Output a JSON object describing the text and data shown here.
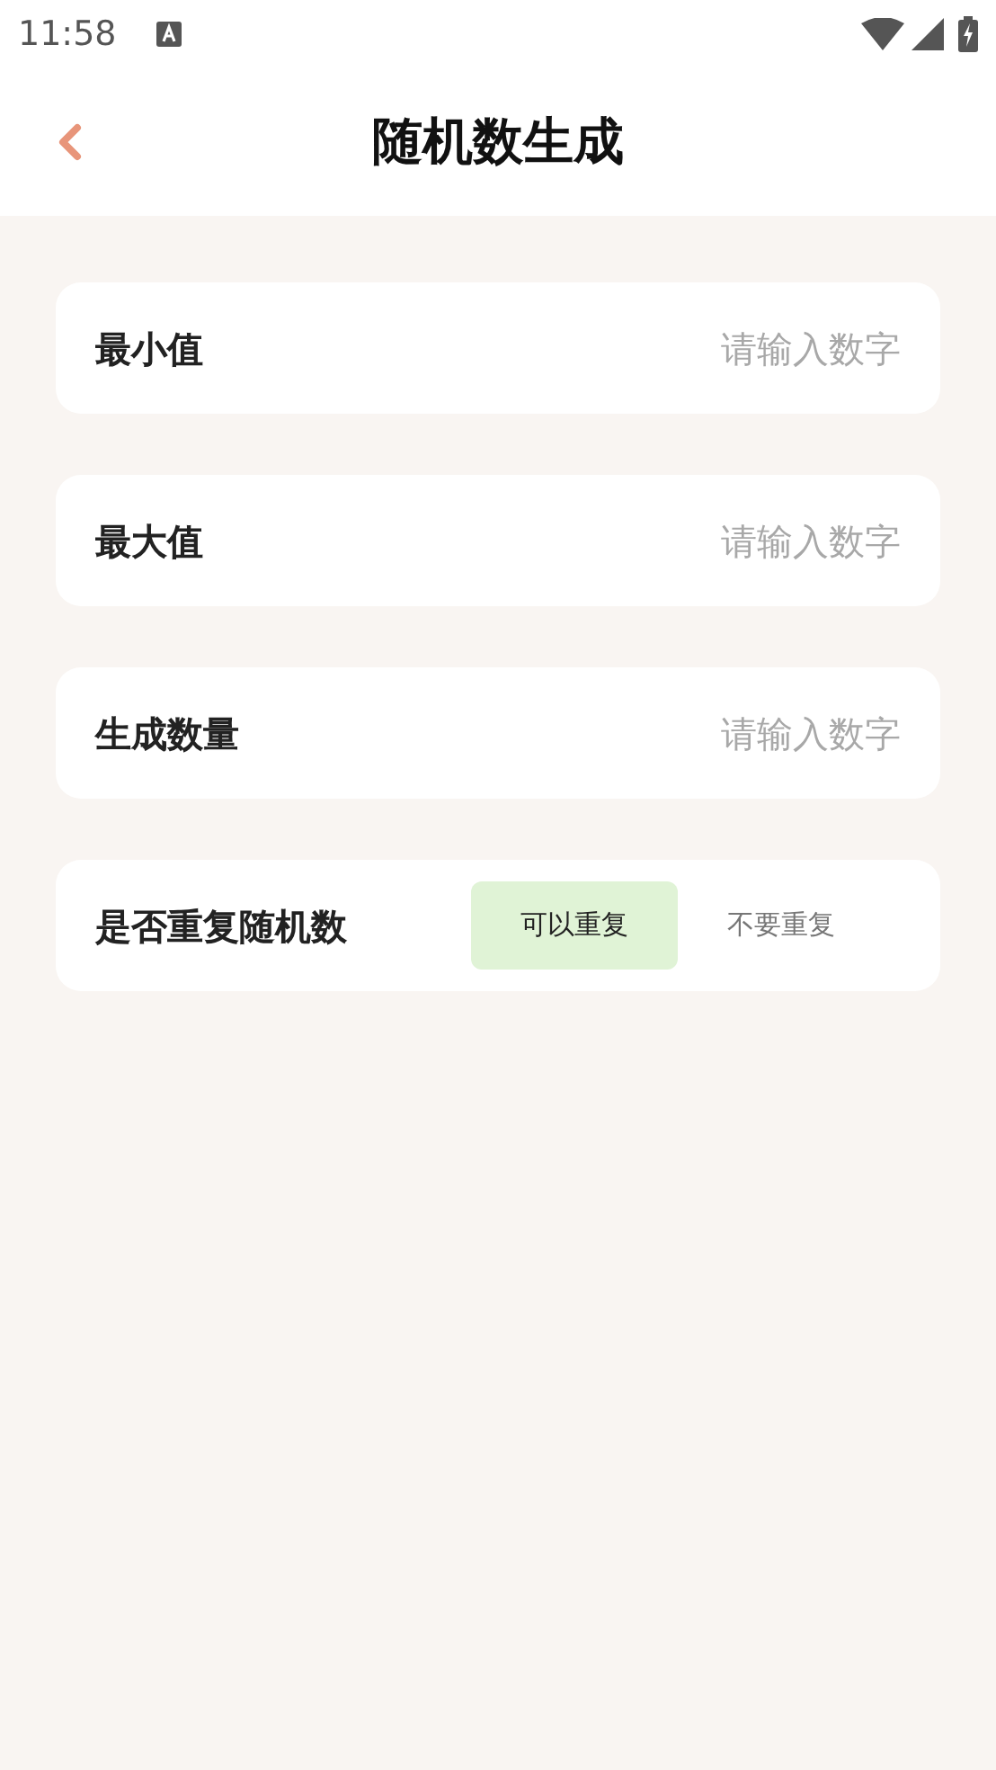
{
  "status_bar": {
    "time": "11:58"
  },
  "header": {
    "title": "随机数生成"
  },
  "fields": [
    {
      "label": "最小值",
      "placeholder": "请输入数字"
    },
    {
      "label": "最大值",
      "placeholder": "请输入数字"
    },
    {
      "label": "生成数量",
      "placeholder": "请输入数字"
    }
  ],
  "repeat": {
    "label": "是否重复随机数",
    "options": [
      {
        "label": "可以重复",
        "selected": true
      },
      {
        "label": "不要重复",
        "selected": false
      }
    ]
  }
}
